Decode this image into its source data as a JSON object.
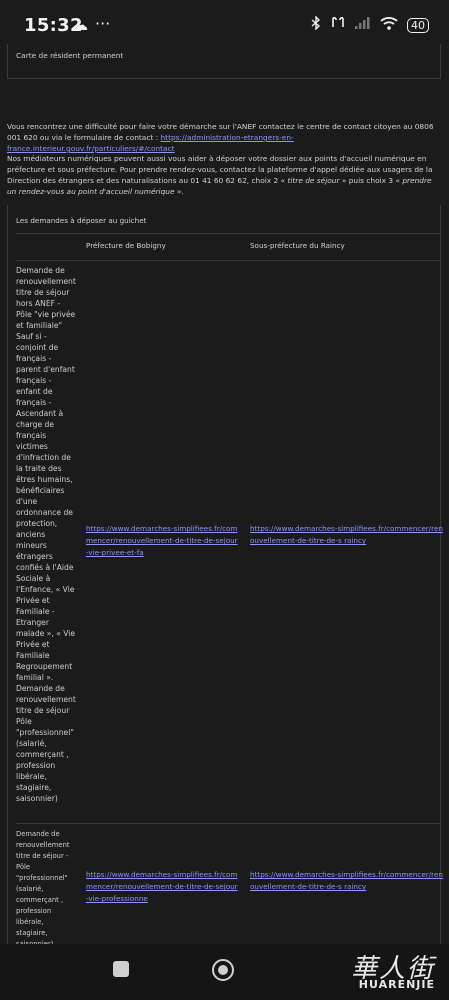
{
  "status_bar": {
    "time": "15:32",
    "cloud_icon": "cloud-icon",
    "more_dots": "···",
    "battery_level": "40"
  },
  "top_card": {
    "label": "Carte de résident permanent"
  },
  "paragraph1": {
    "text_before": "Vous rencontrez une difficulté pour faire votre démarche sur l'ANEF contactez le centre de contact citoyen au 0806 001 620 ou via le formulaire de contact : ",
    "link": "https://administration-etrangers-en-france.interieur.gouv.fr/particuliers/#/contact"
  },
  "paragraph2": {
    "text1": "Nos médiateurs numériques peuvent aussi vous aider à déposer votre dossier aux points d'accueil numérique en préfecture et sous préfecture. Pour prendre rendez-vous, contactez la plateforme d'appel dédiée aux usagers de la Direction des étrangers et des naturalisations au 01 41 60 62 62, choix 2 « ",
    "italic1": "titre de séjour",
    "text2": " » puis choix 3 « ",
    "italic2": "prendre un rendez-vous au point d'accueil numérique",
    "text3": " »."
  },
  "table": {
    "caption": "Les demandes à déposer au guichet",
    "headers": [
      "Préfecture de Bobigny",
      "Sous-préfecture du Raincy"
    ],
    "rows": [
      {
        "label": "Demande de renouvellement titre de séjour hors ANEF - Pôle \"vie privée et familiale\" Sauf si - conjoint de français - parent d'enfant français - enfant de français - Ascendant à charge de français victimes d'infraction de la traite des êtres humains, bénéficiaires d'une ordonnance de protection, anciens mineurs étrangers confiés à l'Aide Sociale à l'Enfance, « Vie Privée et Familiale - Etranger malade », « Vie Privée et Familiale Regroupement familial ». Demande de renouvellement titre de séjour Pôle \"professionnel\" (salarié, commerçant , profession libérale, stagiaire, saisonnier)",
        "bobigny": "https://www.demarches-simplifiees.fr/commencer/renouvellement-de-titre-de-sejour-vie-privee-et-fa",
        "raincy": "https://www.demarches-simplifiees.fr/commencer/renouvellement-de-titre-de-s raincy"
      },
      {
        "label": "Demande de renouvellement titre de séjour - Pôle \"professionnel\" (salarié, commerçant , profession libérale, stagiaire, saisonnier)",
        "bobigny": "https://www.demarches-simplifiees.fr/commencer/renouvellement-de-titre-de-sejour-vie-professionne",
        "raincy": "https://www.demarches-simplifiees.fr/commencer/renouvellement-de-titre-de-s raincy"
      }
    ]
  },
  "watermark": {
    "cjk": "華人街",
    "latin": "HUARENJIE"
  }
}
